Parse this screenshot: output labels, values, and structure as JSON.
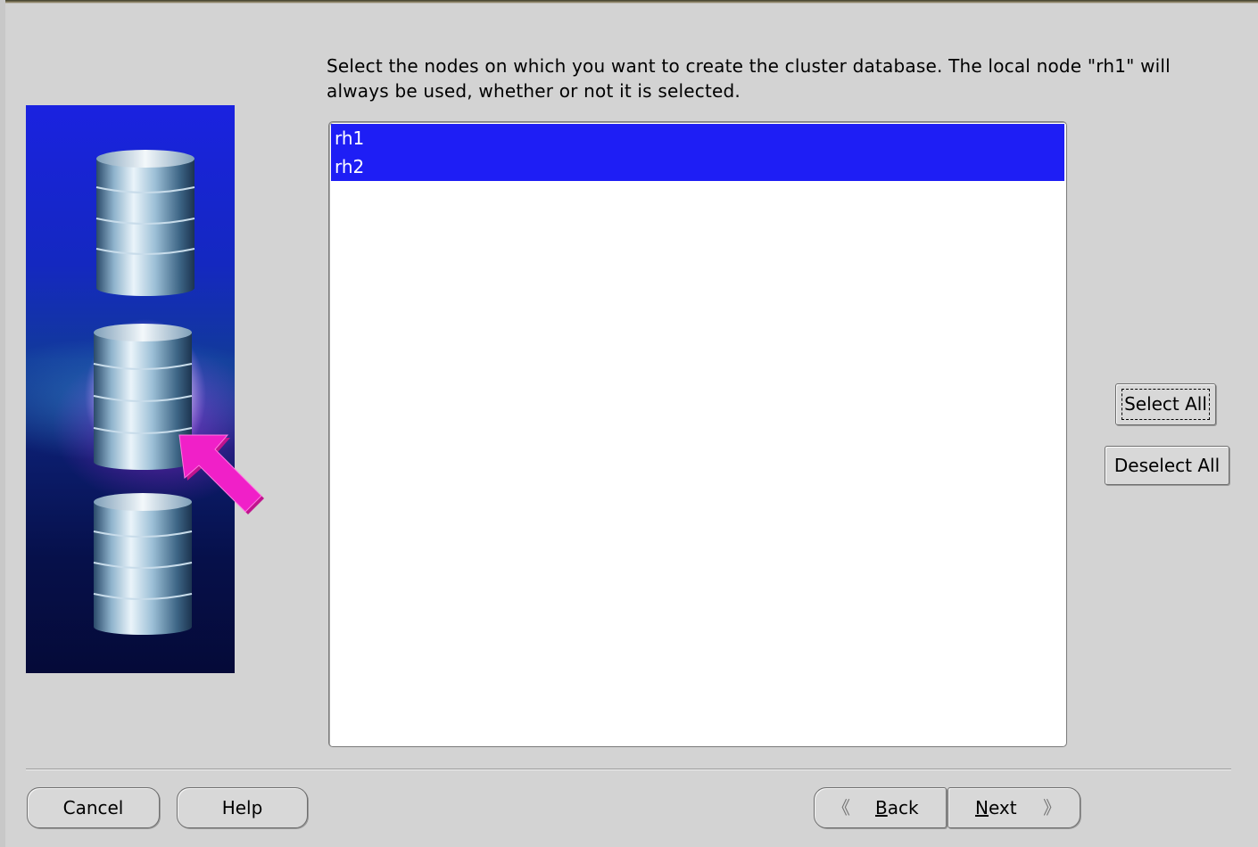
{
  "instruction": {
    "line1": "Select the nodes on which you want to create the cluster database. The local node \"rh1\" will",
    "line2": "always be used, whether or not it is selected."
  },
  "nodes": [
    {
      "name": "rh1",
      "selected": true
    },
    {
      "name": "rh2",
      "selected": true
    }
  ],
  "side_buttons": {
    "select_all": "Select All",
    "deselect_all": "Deselect All"
  },
  "footer": {
    "cancel": "Cancel",
    "help": "Help",
    "back": {
      "mnemonic": "B",
      "rest": "ack"
    },
    "next": {
      "mnemonic": "N",
      "rest": "ext"
    }
  },
  "icons": {
    "back": "double-chevron-left-icon",
    "next": "double-chevron-right-icon",
    "illustration": "cluster-database-nodes-illustration"
  },
  "colors": {
    "selection": "#1e1ef5",
    "arrow": "#f020c8",
    "background": "#d3d3d3"
  }
}
